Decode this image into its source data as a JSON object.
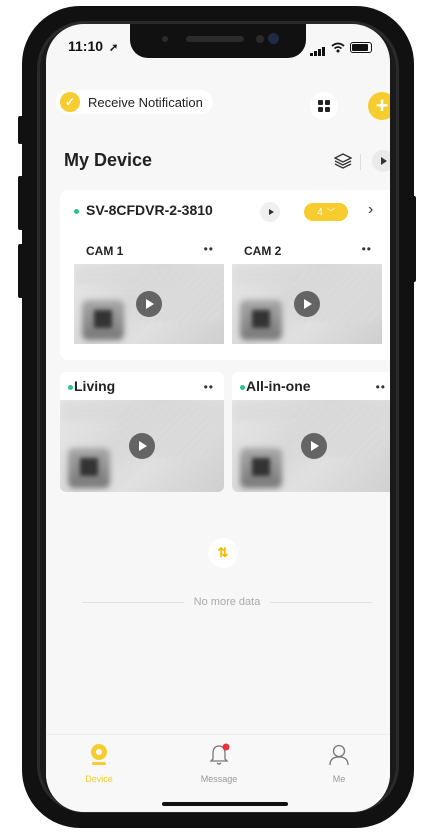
{
  "status": {
    "time": "11:10"
  },
  "toolbar": {
    "notification_label": "Receive Notification"
  },
  "page": {
    "title": "My Device"
  },
  "nvr": {
    "name": "SV-8CFDVR-2-3810",
    "channel_count": "4",
    "cameras": [
      {
        "name": "CAM 1",
        "more": "••"
      },
      {
        "name": "CAM 2",
        "more": "••"
      }
    ]
  },
  "devices": [
    {
      "name": "Living",
      "more": "••"
    },
    {
      "name": "All-in-one",
      "more": "••"
    }
  ],
  "footer": {
    "no_more": "No more data"
  },
  "tabs": [
    {
      "label": "Device",
      "icon": "device-icon",
      "active": true
    },
    {
      "label": "Message",
      "icon": "bell-icon",
      "active": false,
      "has_badge": true
    },
    {
      "label": "Me",
      "icon": "person-icon",
      "active": false
    }
  ],
  "colors": {
    "accent": "#f7cc2e",
    "online": "#2bc28a",
    "badge": "#e8323c"
  }
}
